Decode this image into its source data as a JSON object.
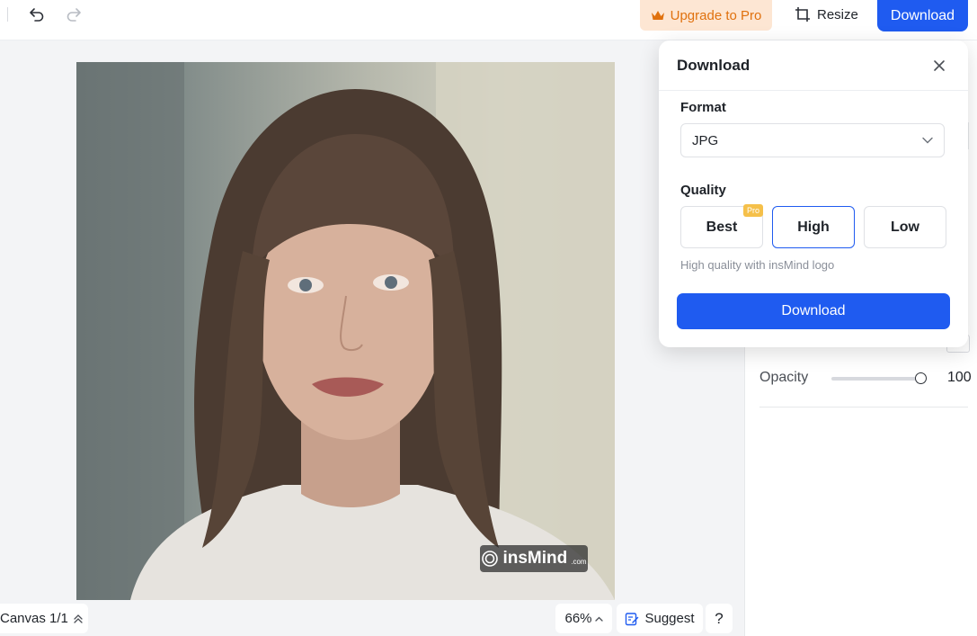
{
  "toolbar": {
    "undo_icon": "undo-icon",
    "redo_icon": "redo-icon",
    "upgrade_label": "Upgrade to Pro",
    "resize_label": "Resize",
    "download_label": "Download",
    "accent_color": "#1f5bf0",
    "upgrade_color": "#e0710e"
  },
  "canvas": {
    "watermark_text": "insMind",
    "watermark_suffix": ".com"
  },
  "download_dialog": {
    "title": "Download",
    "format_label": "Format",
    "format_value": "JPG",
    "quality_label": "Quality",
    "quality_options": [
      "Best",
      "High",
      "Low"
    ],
    "selected_quality": "High",
    "pro_badge": "Pro",
    "quality_hint": "High quality with insMind logo",
    "download_button": "Download"
  },
  "properties": {
    "opacity_label": "Opacity",
    "opacity_value": "100"
  },
  "bottom_bar": {
    "canvas_label": "Canvas 1/1",
    "zoom_label": "66%",
    "suggest_label": "Suggest",
    "help_label": "?"
  }
}
